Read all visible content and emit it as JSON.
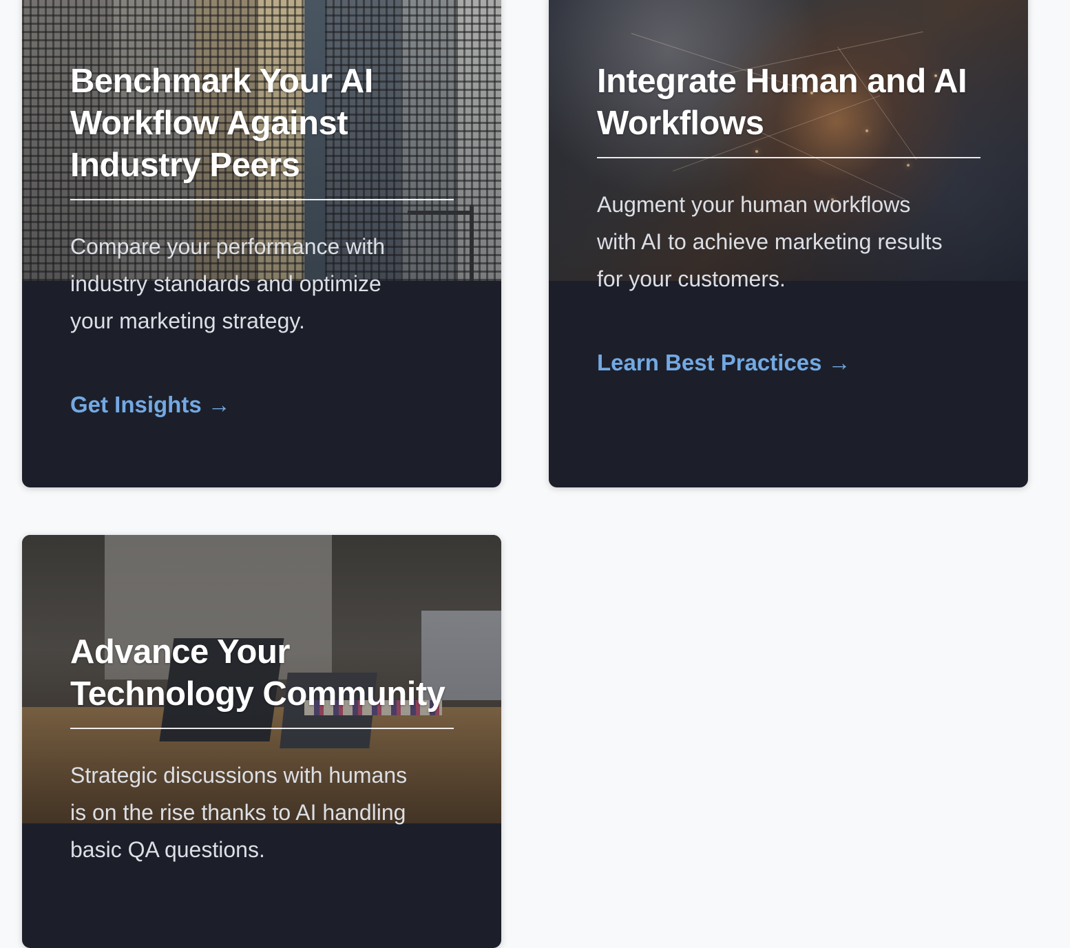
{
  "cards": [
    {
      "title": "Benchmark Your AI Workflow Against Industry Peers",
      "description": "Compare your performance with industry standards and optimize your marketing strategy.",
      "link": "Get Insights →",
      "image": "city-skyscrapers"
    },
    {
      "title": "Integrate Human and AI Workflows",
      "description": "Augment your human workflows with AI to achieve marketing results for your customers.",
      "link": "Learn Best Practices →",
      "image": "hands-network"
    },
    {
      "title": "Advance Your Technology Community",
      "description": "Strategic discussions with humans is on the rise thanks to AI handling basic QA questions.",
      "image": "team-meeting"
    }
  ],
  "colors": {
    "page_background": "#f8f9fb",
    "card_background": "#1c1f29",
    "link": "#73a9e4",
    "title": "#ffffff",
    "description": "#dcdfe5"
  }
}
